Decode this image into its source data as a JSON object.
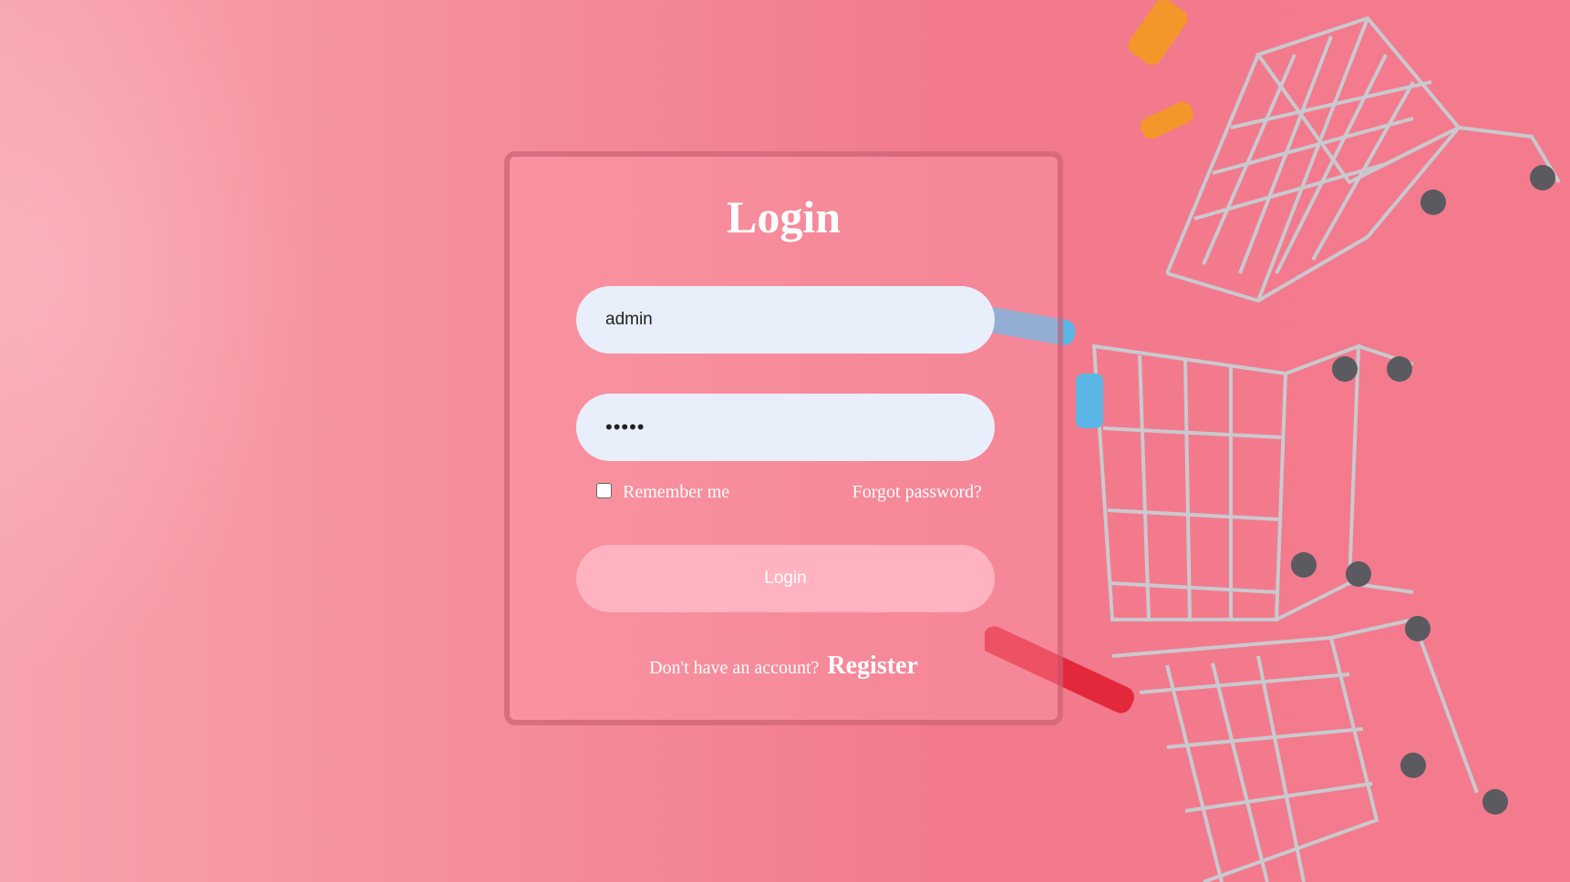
{
  "form": {
    "title": "Login",
    "username_value": "admin",
    "password_value": "•••••",
    "remember_label": "Remember me",
    "forgot_label": "Forgot password?",
    "login_button": "Login",
    "register_prompt": "Don't have an account?",
    "register_link": "Register"
  },
  "colors": {
    "background": "#f48a98",
    "field": "#e9effa",
    "button": "#ffb3c0",
    "text": "#ffffff"
  }
}
